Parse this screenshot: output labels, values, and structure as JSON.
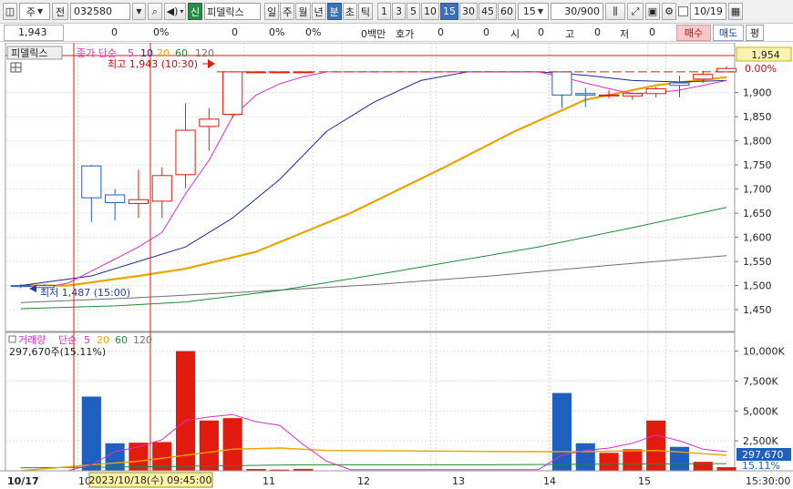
{
  "toolbar": {
    "type_select": "주",
    "prev_label": "전",
    "code": "032580",
    "new_badge": "신",
    "stock_name": "피델릭스",
    "periods": [
      "일",
      "주",
      "월",
      "년",
      "분",
      "초",
      "틱"
    ],
    "active_period": "분",
    "intervals": [
      "1",
      "3",
      "5",
      "10",
      "15",
      "30",
      "45",
      "60"
    ],
    "active_interval": "15",
    "interval_select": "15",
    "count": "30/900",
    "date": "10/19"
  },
  "inforow": {
    "price": "1,943",
    "v1": "0",
    "v2": "0%",
    "v3": "0",
    "v4": "0%",
    "v5": "0%",
    "v6": "0백만",
    "hoga_label": "호가",
    "hoga_v1": "0",
    "hoga_v2": "0",
    "si_label": "시",
    "si_value": "0",
    "go_label": "고",
    "go_value": "0",
    "jeo_label": "저",
    "jeo_value": "0",
    "buy_label": "매수",
    "sell_label": "매도",
    "eval_label": "평"
  },
  "price_panel": {
    "stock_label": "피델릭스",
    "legend_title": "종가 단순",
    "legend_periods": [
      "5",
      "10",
      "20",
      "60",
      "120"
    ],
    "high_annotation": "최고 1,943 (10:30)",
    "low_annotation": "최저 1,487 (15:00)",
    "current_price": "1,954",
    "current_pct": "0.00%"
  },
  "volume_panel": {
    "legend_title": "거래량",
    "legend_sub": "단순",
    "legend_periods": [
      "5",
      "20",
      "60",
      "120"
    ],
    "summary": "297,670주(15.11%)",
    "current_volume": "297,670",
    "current_pct": "15.11%"
  },
  "axis": {
    "start_date": "10/17",
    "crosshair_time": "2023/10/18(수) 09:45:00",
    "end_time": "15:30:00"
  },
  "colors": {
    "up": "#e31b0e",
    "down": "#1f5fc0",
    "ma5": "#d62fc4",
    "ma10": "#1a2a8c",
    "ma20": "#e8a500",
    "ma60": "#1e8a3c",
    "ma120": "#707070"
  },
  "chart_data": {
    "type": "candlestick",
    "price_ylim": [
      1420,
      1990
    ],
    "price_ticks": [
      1450,
      1500,
      1550,
      1600,
      1650,
      1700,
      1750,
      1800,
      1850,
      1900
    ],
    "volume_ylim": [
      0,
      10500
    ],
    "volume_ticks_k": [
      2500,
      5000,
      7500,
      10000
    ],
    "x_labels": [
      "10",
      "11",
      "12",
      "13",
      "14",
      "15"
    ],
    "candles": [
      {
        "i": 0,
        "o": 1500,
        "h": 1503,
        "l": 1495,
        "c": 1498,
        "v": 0
      },
      {
        "i": 1,
        "o": 1500,
        "h": 1503,
        "l": 1495,
        "c": 1496,
        "v": 0
      },
      {
        "i": 3,
        "o": 1748,
        "h": 1750,
        "l": 1632,
        "c": 1682,
        "v": 6200
      },
      {
        "i": 4,
        "o": 1688,
        "h": 1700,
        "l": 1635,
        "c": 1672,
        "v": 2300
      },
      {
        "i": 5,
        "o": 1670,
        "h": 1740,
        "l": 1640,
        "c": 1678,
        "v": 2350
      },
      {
        "i": 6,
        "o": 1675,
        "h": 1745,
        "l": 1640,
        "c": 1728,
        "v": 2400
      },
      {
        "i": 7,
        "o": 1730,
        "h": 1878,
        "l": 1702,
        "c": 1822,
        "v": 10000
      },
      {
        "i": 8,
        "o": 1830,
        "h": 1868,
        "l": 1780,
        "c": 1845,
        "v": 4200
      },
      {
        "i": 9,
        "o": 1855,
        "h": 1943,
        "l": 1848,
        "c": 1943,
        "v": 4400
      },
      {
        "i": 10,
        "o": 1943,
        "h": 1943,
        "l": 1943,
        "c": 1943,
        "v": 150
      },
      {
        "i": 11,
        "o": 1943,
        "h": 1943,
        "l": 1943,
        "c": 1943,
        "v": 100
      },
      {
        "i": 12,
        "o": 1943,
        "h": 1943,
        "l": 1943,
        "c": 1943,
        "v": 160
      },
      {
        "i": 23,
        "o": 1943,
        "h": 1943,
        "l": 1868,
        "c": 1895,
        "v": 6500
      },
      {
        "i": 24,
        "o": 1898,
        "h": 1910,
        "l": 1870,
        "c": 1895,
        "v": 2300
      },
      {
        "i": 25,
        "o": 1895,
        "h": 1905,
        "l": 1888,
        "c": 1895,
        "v": 1500
      },
      {
        "i": 26,
        "o": 1893,
        "h": 1900,
        "l": 1885,
        "c": 1898,
        "v": 1800
      },
      {
        "i": 27,
        "o": 1898,
        "h": 1912,
        "l": 1890,
        "c": 1908,
        "v": 4200
      },
      {
        "i": 28,
        "o": 1920,
        "h": 1935,
        "l": 1890,
        "c": 1915,
        "v": 2000
      },
      {
        "i": 29,
        "o": 1928,
        "h": 1945,
        "l": 1920,
        "c": 1938,
        "v": 750
      },
      {
        "i": 30,
        "o": 1943,
        "h": 1954,
        "l": 1943,
        "c": 1950,
        "v": 298
      }
    ],
    "ma5": [
      [
        0,
        1500
      ],
      [
        1,
        1496
      ],
      [
        2,
        1505
      ],
      [
        3,
        1530
      ],
      [
        4,
        1555
      ],
      [
        5,
        1580
      ],
      [
        6,
        1610
      ],
      [
        7,
        1690
      ],
      [
        8,
        1760
      ],
      [
        9,
        1850
      ],
      [
        10,
        1895
      ],
      [
        11,
        1918
      ],
      [
        12,
        1933
      ],
      [
        13,
        1943
      ],
      [
        22,
        1943
      ],
      [
        23,
        1932
      ],
      [
        24,
        1920
      ],
      [
        25,
        1908
      ],
      [
        26,
        1898
      ],
      [
        27,
        1900
      ],
      [
        28,
        1905
      ],
      [
        29,
        1915
      ],
      [
        30,
        1925
      ]
    ],
    "ma10": [
      [
        0,
        1500
      ],
      [
        3,
        1520
      ],
      [
        5,
        1550
      ],
      [
        7,
        1580
      ],
      [
        9,
        1640
      ],
      [
        11,
        1720
      ],
      [
        13,
        1820
      ],
      [
        15,
        1880
      ],
      [
        17,
        1925
      ],
      [
        19,
        1943
      ],
      [
        22,
        1943
      ],
      [
        24,
        1936
      ],
      [
        26,
        1925
      ],
      [
        28,
        1922
      ],
      [
        30,
        1925
      ]
    ],
    "ma20": [
      [
        0,
        1500
      ],
      [
        2,
        1500
      ],
      [
        5,
        1520
      ],
      [
        7,
        1535
      ],
      [
        10,
        1570
      ],
      [
        14,
        1650
      ],
      [
        18,
        1745
      ],
      [
        21,
        1820
      ],
      [
        24,
        1885
      ],
      [
        27,
        1915
      ],
      [
        30,
        1932
      ]
    ],
    "ma60": [
      [
        0,
        1452
      ],
      [
        4,
        1458
      ],
      [
        7,
        1466
      ],
      [
        11,
        1490
      ],
      [
        16,
        1530
      ],
      [
        22,
        1580
      ],
      [
        26,
        1620
      ],
      [
        30,
        1662
      ]
    ],
    "ma120": [
      [
        0,
        1465
      ],
      [
        5,
        1475
      ],
      [
        10,
        1488
      ],
      [
        15,
        1502
      ],
      [
        20,
        1520
      ],
      [
        25,
        1542
      ],
      [
        30,
        1562
      ]
    ],
    "vma5": [
      [
        0,
        0
      ],
      [
        2,
        10
      ],
      [
        3,
        500
      ],
      [
        4,
        1600
      ],
      [
        5,
        2000
      ],
      [
        6,
        2600
      ],
      [
        7,
        4200
      ],
      [
        8,
        4500
      ],
      [
        9,
        4700
      ],
      [
        10,
        4100
      ],
      [
        11,
        3800
      ],
      [
        12,
        2200
      ],
      [
        13,
        800
      ],
      [
        14,
        100
      ],
      [
        22,
        100
      ],
      [
        23,
        1300
      ],
      [
        24,
        1700
      ],
      [
        25,
        1900
      ],
      [
        26,
        2300
      ],
      [
        27,
        3000
      ],
      [
        28,
        2500
      ],
      [
        29,
        1800
      ],
      [
        30,
        1600
      ]
    ],
    "vma20": [
      [
        0,
        0
      ],
      [
        3,
        500
      ],
      [
        5,
        800
      ],
      [
        7,
        1300
      ],
      [
        9,
        1800
      ],
      [
        11,
        1900
      ],
      [
        13,
        1700
      ],
      [
        22,
        1600
      ],
      [
        24,
        1600
      ],
      [
        27,
        1700
      ],
      [
        30,
        1300
      ]
    ],
    "vma60": [
      [
        0,
        250
      ],
      [
        6,
        350
      ],
      [
        12,
        500
      ],
      [
        20,
        500
      ],
      [
        30,
        600
      ]
    ]
  }
}
